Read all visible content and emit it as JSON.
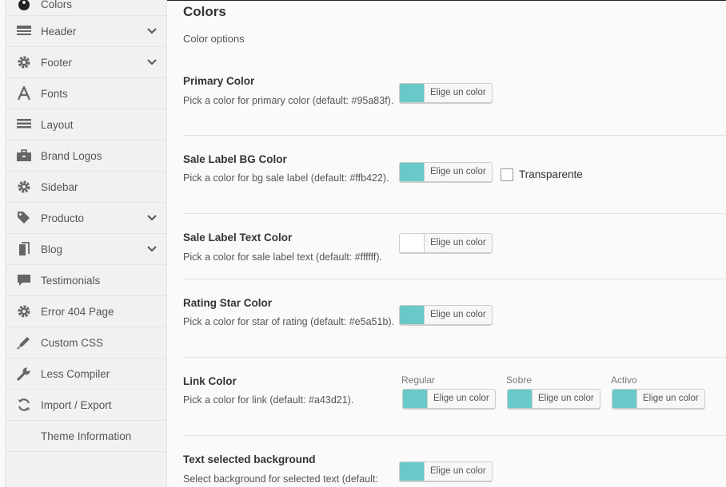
{
  "sidebar": {
    "items": [
      {
        "label": "Colors",
        "icon": "palette-icon",
        "chevron": false
      },
      {
        "label": "Header",
        "icon": "header-icon",
        "chevron": true
      },
      {
        "label": "Footer",
        "icon": "gear-icon",
        "chevron": true
      },
      {
        "label": "Fonts",
        "icon": "font-icon",
        "chevron": false
      },
      {
        "label": "Layout",
        "icon": "layout-icon",
        "chevron": false
      },
      {
        "label": "Brand Logos",
        "icon": "briefcase-icon",
        "chevron": false
      },
      {
        "label": "Sidebar",
        "icon": "gear-icon",
        "chevron": false
      },
      {
        "label": "Producto",
        "icon": "tags-icon",
        "chevron": true
      },
      {
        "label": "Blog",
        "icon": "document-icon",
        "chevron": true
      },
      {
        "label": "Testimonials",
        "icon": "comment-icon",
        "chevron": false
      },
      {
        "label": "Error 404 Page",
        "icon": "gear-icon",
        "chevron": false
      },
      {
        "label": "Custom CSS",
        "icon": "pencil-icon",
        "chevron": false
      },
      {
        "label": "Less Compiler",
        "icon": "wrench-icon",
        "chevron": false
      },
      {
        "label": "Import / Export",
        "icon": "refresh-icon",
        "chevron": false
      },
      {
        "label": "Theme Information",
        "icon": "",
        "chevron": false
      }
    ]
  },
  "main": {
    "title": "Colors",
    "subtitle": "Color options",
    "button_label": "Elige un color",
    "colors": {
      "teal": "#69c9c8",
      "white": "#ffffff"
    },
    "rows": [
      {
        "title": "Primary Color",
        "desc": "Pick a color for primary color (default: #95a83f)."
      },
      {
        "title": "Sale Label BG Color",
        "desc": "Pick a color for bg sale label (default: #ffb422)."
      },
      {
        "title": "Sale Label Text Color",
        "desc": "Pick a color for sale label text (default: #ffffff)."
      },
      {
        "title": "Rating Star Color",
        "desc": "Pick a color for star of rating (default: #e5a51b)."
      },
      {
        "title": "Link Color",
        "desc": "Pick a color for link (default: #a43d21)."
      },
      {
        "title": "Text selected background",
        "desc": "Select background for selected text (default:"
      }
    ],
    "transparent_label": "Transparente",
    "link_states": [
      "Regular",
      "Sobre",
      "Activo"
    ]
  }
}
